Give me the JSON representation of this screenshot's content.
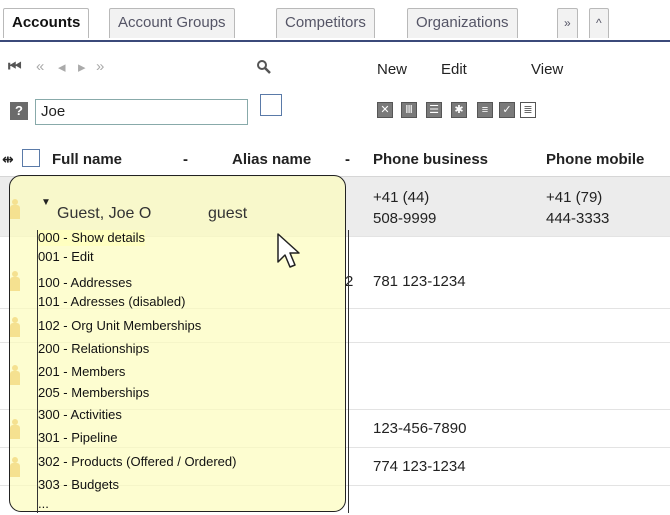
{
  "tabs": [
    {
      "label": "Accounts",
      "active": true
    },
    {
      "label": "Account Groups"
    },
    {
      "label": "Competitors"
    },
    {
      "label": "Organizations"
    },
    {
      "label": "»"
    },
    {
      "label": "^"
    }
  ],
  "nav": {
    "first": "⏮",
    "prev_page": "«",
    "prev": "◂",
    "next": "▸",
    "next_page": "»",
    "search_icon": "magnifier-icon",
    "new_label": "New",
    "edit_label": "Edit",
    "view_label": "View"
  },
  "filter": {
    "help": "?",
    "search_value": "Joe",
    "toolbar_icons": [
      "export-excel-icon",
      "columns-icon",
      "table-icon",
      "settings-icon",
      "document-icon",
      "checklist-icon",
      "list-icon"
    ]
  },
  "columns": {
    "full_name": "Full name",
    "alias_name": "Alias name",
    "phone_business": "Phone business",
    "phone_mobile": "Phone mobile",
    "sort_marker": "-"
  },
  "rows": [
    {
      "full_name": "Guest, Joe O",
      "alias": "guest",
      "phone_business_1": "+41 (44)",
      "phone_business_2": "508-9999",
      "phone_mobile_1": "+41 (79)",
      "phone_mobile_2": "444-3333"
    },
    {
      "alias_tail": "2",
      "phone_business": "781 123-1234"
    },
    {},
    {},
    {
      "phone_business": "123-456-7890"
    },
    {
      "phone_business": "774 123-1234"
    }
  ],
  "menu": {
    "items": [
      "000 - Show details",
      "001 - Edit",
      "100 - Addresses",
      "101 - Adresses (disabled)",
      "102 - Org Unit Memberships",
      "200 - Relationships",
      "201 - Members",
      "205 - Memberships",
      "300 - Activities",
      "301 - Pipeline",
      "302 - Products (Offered / Ordered)",
      "303 - Budgets",
      "..."
    ],
    "caret": "▼"
  },
  "colors": {
    "accent": "#3b4a7a",
    "person_icon": "#e39c1a",
    "popup_bg": "#fcfcbe"
  }
}
